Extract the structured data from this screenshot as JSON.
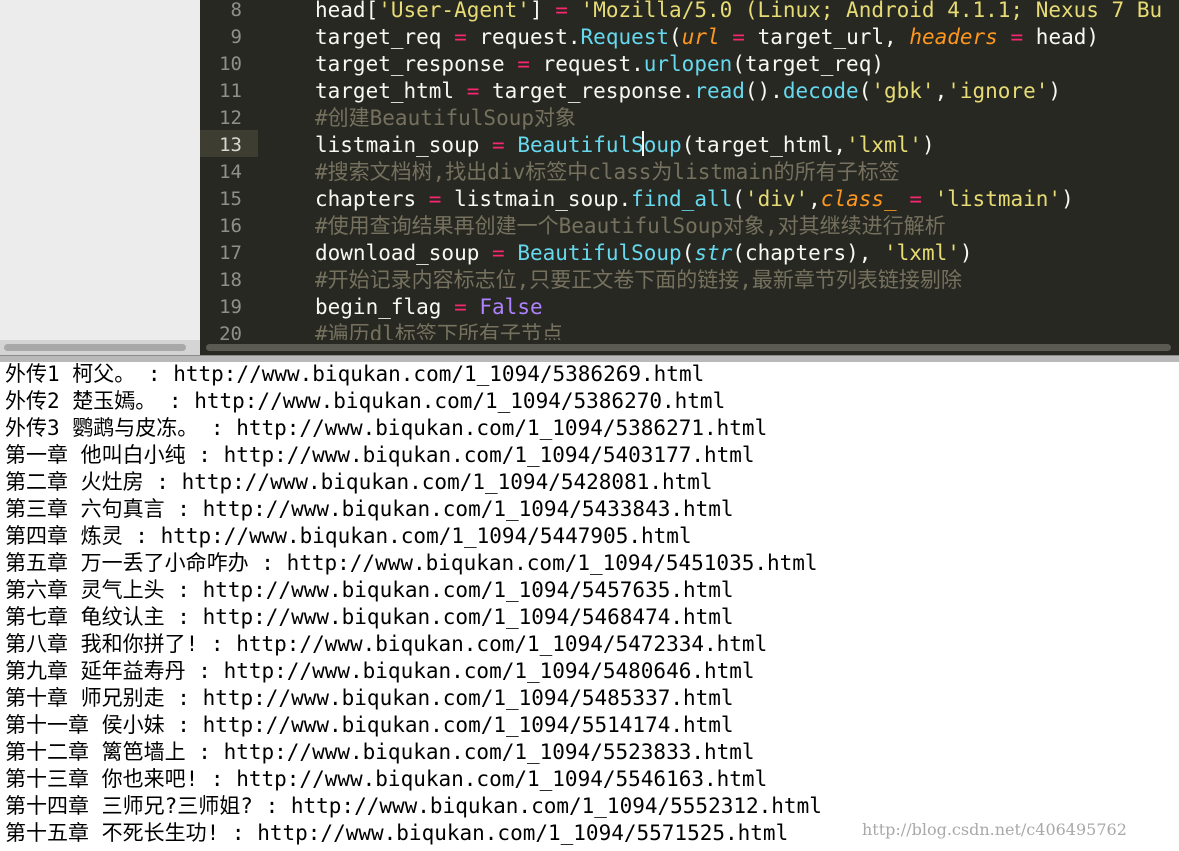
{
  "colors": {
    "editor_bg": "#272822",
    "default_text": "#f8f8f2",
    "string": "#e6db74",
    "operator": "#f92672",
    "function": "#66d9ef",
    "keyword_arg": "#fd971f",
    "comment": "#75715e",
    "constant": "#ae81ff",
    "console_bg": "#ffffff",
    "console_text": "#000000"
  },
  "editor": {
    "current_line": "13",
    "line_numbers": [
      "8",
      "9",
      "10",
      "11",
      "12",
      "13",
      "14",
      "15",
      "16",
      "17",
      "18",
      "19",
      "20"
    ],
    "lines": [
      {
        "num": "8",
        "tokens": [
          {
            "t": "head["
          },
          {
            "t": "'User-Agent'",
            "c": "str"
          },
          {
            "t": "] "
          },
          {
            "t": "=",
            "c": "op"
          },
          {
            "t": " "
          },
          {
            "t": "'Mozilla/5.0 (Linux; Android 4.1.1; Nexus 7 Bu",
            "c": "str"
          }
        ]
      },
      {
        "num": "9",
        "tokens": [
          {
            "t": "target_req "
          },
          {
            "t": "=",
            "c": "op"
          },
          {
            "t": " request."
          },
          {
            "t": "Request",
            "c": "fn"
          },
          {
            "t": "("
          },
          {
            "t": "url",
            "c": "kw"
          },
          {
            "t": " "
          },
          {
            "t": "=",
            "c": "op"
          },
          {
            "t": " target_url, "
          },
          {
            "t": "headers",
            "c": "kw"
          },
          {
            "t": " "
          },
          {
            "t": "=",
            "c": "op"
          },
          {
            "t": " head)"
          }
        ]
      },
      {
        "num": "10",
        "tokens": [
          {
            "t": "target_response "
          },
          {
            "t": "=",
            "c": "op"
          },
          {
            "t": " request."
          },
          {
            "t": "urlopen",
            "c": "fn"
          },
          {
            "t": "(target_req)"
          }
        ]
      },
      {
        "num": "11",
        "tokens": [
          {
            "t": "target_html "
          },
          {
            "t": "=",
            "c": "op"
          },
          {
            "t": " target_response."
          },
          {
            "t": "read",
            "c": "fn"
          },
          {
            "t": "()."
          },
          {
            "t": "decode",
            "c": "fn"
          },
          {
            "t": "("
          },
          {
            "t": "'gbk'",
            "c": "str"
          },
          {
            "t": ","
          },
          {
            "t": "'ignore'",
            "c": "str"
          },
          {
            "t": ")"
          }
        ]
      },
      {
        "num": "12",
        "tokens": [
          {
            "t": "#创建BeautifulSoup对象",
            "c": "cm"
          }
        ]
      },
      {
        "num": "13",
        "tokens": [
          {
            "t": "listmain_soup "
          },
          {
            "t": "=",
            "c": "op"
          },
          {
            "t": " "
          },
          {
            "t": "BeautifulSoup",
            "c": "fn"
          },
          {
            "t": "(target_html,"
          },
          {
            "t": "'lxml'",
            "c": "str"
          },
          {
            "t": ")"
          }
        ]
      },
      {
        "num": "14",
        "tokens": [
          {
            "t": "#搜索文档树,找出div标签中class为listmain的所有子标签",
            "c": "cm"
          }
        ]
      },
      {
        "num": "15",
        "tokens": [
          {
            "t": "chapters "
          },
          {
            "t": "=",
            "c": "op"
          },
          {
            "t": " listmain_soup."
          },
          {
            "t": "find_all",
            "c": "fn"
          },
          {
            "t": "("
          },
          {
            "t": "'div'",
            "c": "str"
          },
          {
            "t": ","
          },
          {
            "t": "class_",
            "c": "kw"
          },
          {
            "t": " "
          },
          {
            "t": "=",
            "c": "op"
          },
          {
            "t": " "
          },
          {
            "t": "'listmain'",
            "c": "str"
          },
          {
            "t": ")"
          }
        ]
      },
      {
        "num": "16",
        "tokens": [
          {
            "t": "#使用查询结果再创建一个BeautifulSoup对象,对其继续进行解析",
            "c": "cm"
          }
        ]
      },
      {
        "num": "17",
        "tokens": [
          {
            "t": "download_soup "
          },
          {
            "t": "=",
            "c": "op"
          },
          {
            "t": " "
          },
          {
            "t": "BeautifulSoup",
            "c": "fn"
          },
          {
            "t": "("
          },
          {
            "t": "str",
            "c": "bi"
          },
          {
            "t": "(chapters), "
          },
          {
            "t": "'lxml'",
            "c": "str"
          },
          {
            "t": ")"
          }
        ]
      },
      {
        "num": "18",
        "tokens": [
          {
            "t": "#开始记录内容标志位,只要正文卷下面的链接,最新章节列表链接剔除",
            "c": "cm"
          }
        ]
      },
      {
        "num": "19",
        "tokens": [
          {
            "t": "begin_flag "
          },
          {
            "t": "=",
            "c": "op"
          },
          {
            "t": " "
          },
          {
            "t": "False",
            "c": "const"
          }
        ]
      },
      {
        "num": "20",
        "tokens": [
          {
            "t": "#遍历dl标签下所有子节点",
            "c": "cm"
          }
        ]
      }
    ]
  },
  "console": {
    "lines": [
      "外传1 柯父。 : http://www.biqukan.com/1_1094/5386269.html",
      "外传2 楚玉嫣。 : http://www.biqukan.com/1_1094/5386270.html",
      "外传3 鹦鹉与皮冻。 : http://www.biqukan.com/1_1094/5386271.html",
      "第一章 他叫白小纯 : http://www.biqukan.com/1_1094/5403177.html",
      "第二章 火灶房 : http://www.biqukan.com/1_1094/5428081.html",
      "第三章 六句真言 : http://www.biqukan.com/1_1094/5433843.html",
      "第四章 炼灵 : http://www.biqukan.com/1_1094/5447905.html",
      "第五章 万一丢了小命咋办 : http://www.biqukan.com/1_1094/5451035.html",
      "第六章 灵气上头 : http://www.biqukan.com/1_1094/5457635.html",
      "第七章 龟纹认主 : http://www.biqukan.com/1_1094/5468474.html",
      "第八章 我和你拼了! : http://www.biqukan.com/1_1094/5472334.html",
      "第九章 延年益寿丹 : http://www.biqukan.com/1_1094/5480646.html",
      "第十章 师兄别走 : http://www.biqukan.com/1_1094/5485337.html",
      "第十一章 侯小妹 : http://www.biqukan.com/1_1094/5514174.html",
      "第十二章 篱笆墙上 : http://www.biqukan.com/1_1094/5523833.html",
      "第十三章 你也来吧! : http://www.biqukan.com/1_1094/5546163.html",
      "第十四章 三师兄?三师姐? : http://www.biqukan.com/1_1094/5552312.html",
      "第十五章 不死长生功! : http://www.biqukan.com/1_1094/5571525.html"
    ]
  },
  "watermark": "http://blog.csdn.net/c406495762"
}
